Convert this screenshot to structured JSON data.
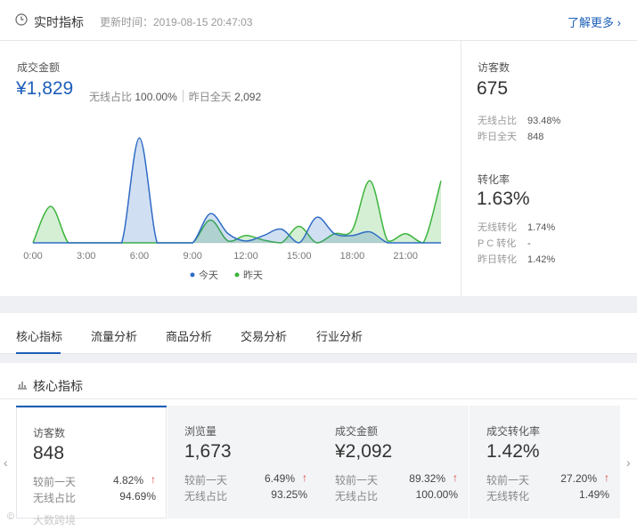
{
  "realtime": {
    "title": "实时指标",
    "update_time": "更新时间：2019-08-15 20:47:03",
    "more_link": "了解更多 ›",
    "sales": {
      "label": "成交金额",
      "value": "¥1,829",
      "wireless_label": "无线占比",
      "wireless_value": "100.00%",
      "yesterday_label": "昨日全天",
      "yesterday_value": "2,092"
    },
    "visitors": {
      "label": "访客数",
      "value": "675",
      "rows": [
        {
          "key": "无线占比",
          "value": "93.48%"
        },
        {
          "key": "昨日全天",
          "value": "848"
        }
      ]
    },
    "conversion": {
      "label": "转化率",
      "value": "1.63%",
      "rows": [
        {
          "key": "无线转化",
          "value": "1.74%"
        },
        {
          "key": "P C 转化",
          "value": "-"
        },
        {
          "key": "昨日转化",
          "value": "1.42%"
        }
      ]
    }
  },
  "chart_data": {
    "type": "area",
    "x_ticks": [
      "0:00",
      "3:00",
      "6:00",
      "9:00",
      "12:00",
      "15:00",
      "18:00",
      "21:00"
    ],
    "x_hours": [
      0,
      1,
      2,
      3,
      4,
      5,
      6,
      7,
      8,
      9,
      10,
      11,
      12,
      13,
      14,
      15,
      16,
      17,
      18,
      19,
      20,
      21,
      22,
      23
    ],
    "series": [
      {
        "name": "今天",
        "color": "#2f6cc6",
        "values": [
          0,
          0,
          0,
          0,
          0,
          0,
          115,
          0,
          0,
          0,
          32,
          10,
          2,
          8,
          15,
          0,
          28,
          10,
          8,
          12,
          0,
          0,
          0,
          0
        ]
      },
      {
        "name": "昨天",
        "color": "#3cb43c",
        "values": [
          0,
          40,
          0,
          0,
          0,
          0,
          0,
          0,
          0,
          0,
          25,
          2,
          8,
          3,
          0,
          18,
          0,
          10,
          14,
          68,
          2,
          10,
          0,
          68
        ]
      }
    ],
    "ylim": [
      0,
      120
    ]
  },
  "tabs": [
    "核心指标",
    "流量分析",
    "商品分析",
    "交易分析",
    "行业分析"
  ],
  "core": {
    "title": "核心指标",
    "cards": [
      {
        "label": "访客数",
        "value": "848",
        "r1k": "较前一天",
        "r1v": "4.82%",
        "r1a": "↑",
        "r2k": "无线占比",
        "r2v": "94.69%"
      },
      {
        "label": "浏览量",
        "value": "1,673",
        "r1k": "较前一天",
        "r1v": "6.49%",
        "r1a": "↑",
        "r2k": "无线占比",
        "r2v": "93.25%"
      },
      {
        "label": "成交金额",
        "value": "¥2,092",
        "r1k": "较前一天",
        "r1v": "89.32%",
        "r1a": "↑",
        "r2k": "无线占比",
        "r2v": "100.00%"
      },
      {
        "label": "成交转化率",
        "value": "1.42%",
        "r1k": "较前一天",
        "r1v": "27.20%",
        "r1a": "↑",
        "r2k": "无线转化",
        "r2v": "1.49%"
      }
    ]
  },
  "watermark": {
    "icon": "©",
    "text": "大数跨境"
  }
}
